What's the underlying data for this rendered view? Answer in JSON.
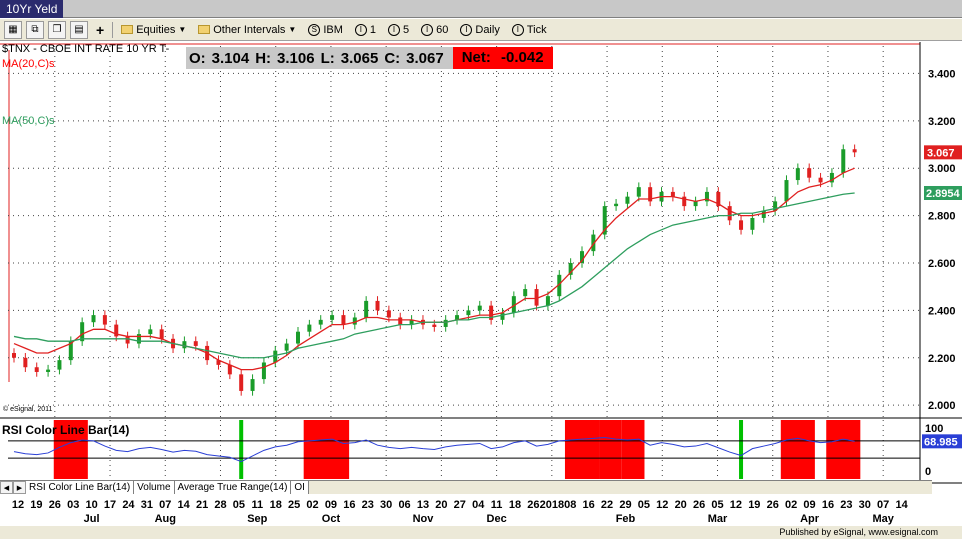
{
  "window": {
    "title": "10Yr Yeld"
  },
  "toolbar": {
    "items": [
      {
        "label": "Equities"
      },
      {
        "label": "Other Intervals"
      },
      {
        "badge": "S",
        "label": "IBM"
      },
      {
        "badge": "I",
        "label": "1"
      },
      {
        "badge": "I",
        "label": "5"
      },
      {
        "badge": "I",
        "label": "60"
      },
      {
        "badge": "I",
        "label": "Daily"
      },
      {
        "badge": "I",
        "label": "Tick"
      }
    ]
  },
  "legend": {
    "symbol": "$TNX - CBOE INT RATE 10 YR T-",
    "ma20": "MA(20,C)s",
    "ma50": "MA(50,C)s",
    "copyright": "© eSignal, 2011"
  },
  "ohlc": {
    "o_label": "O:",
    "o": "3.104",
    "h_label": "H:",
    "h": "3.106",
    "l_label": "L:",
    "l": "3.065",
    "c_label": "C:",
    "c": "3.067",
    "net_label": "Net:",
    "net": "-0.042"
  },
  "tabs": [
    "RSI Color Line Bar(14)",
    "Volume",
    "Average True Range(14)",
    "OI"
  ],
  "footer": "Published by eSignal, www.esignal.com",
  "colors": {
    "up": "#1a9c2a",
    "down": "#e02020",
    "ma20": "#e02020",
    "ma50": "#2e9e5e",
    "rsi": "#2a3fd6",
    "rsi_zone": "#ff0000",
    "alert": "#00c000"
  },
  "chart_data": [
    {
      "type": "candlestick",
      "title": "$TNX - CBOE INT RATE 10 YR T-",
      "ylim": [
        1.95,
        3.52
      ],
      "y_ticks": [
        "2.000",
        "2.200",
        "2.400",
        "2.600",
        "2.800",
        "3.000",
        "3.200",
        "3.400"
      ],
      "x_tick_labels": [
        "12",
        "19",
        "26",
        "03",
        "10",
        "17",
        "24",
        "31",
        "07",
        "14",
        "21",
        "28",
        "05",
        "11",
        "18",
        "25",
        "02",
        "09",
        "16",
        "23",
        "30",
        "06",
        "13",
        "20",
        "27",
        "04",
        "11",
        "18",
        "26",
        "2018",
        "08",
        "16",
        "22",
        "29",
        "05",
        "12",
        "20",
        "26",
        "05",
        "12",
        "19",
        "26",
        "02",
        "09",
        "16",
        "23",
        "30",
        "07",
        "14"
      ],
      "month_labels": [
        "Jul",
        "Aug",
        "Sep",
        "Oct",
        "Nov",
        "Dec",
        "Feb",
        "Mar",
        "Apr",
        "May"
      ],
      "last_price_label": "3.067",
      "ma50_label": "2.8954",
      "series": [
        {
          "name": "$TNX",
          "values": [
            2.2,
            2.16,
            2.14,
            2.15,
            2.19,
            2.27,
            2.35,
            2.38,
            2.34,
            2.29,
            2.26,
            2.3,
            2.32,
            2.28,
            2.24,
            2.27,
            2.25,
            2.19,
            2.17,
            2.13,
            2.06,
            2.11,
            2.18,
            2.23,
            2.26,
            2.31,
            2.34,
            2.36,
            2.38,
            2.34,
            2.37,
            2.44,
            2.4,
            2.37,
            2.34,
            2.36,
            2.34,
            2.33,
            2.36,
            2.38,
            2.4,
            2.42,
            2.36,
            2.39,
            2.46,
            2.49,
            2.42,
            2.46,
            2.55,
            2.6,
            2.65,
            2.72,
            2.84,
            2.85,
            2.88,
            2.92,
            2.86,
            2.9,
            2.88,
            2.84,
            2.86,
            2.9,
            2.84,
            2.78,
            2.74,
            2.79,
            2.82,
            2.86,
            2.95,
            3.0,
            2.96,
            2.94,
            2.98,
            3.08,
            3.067
          ]
        },
        {
          "name": "MA(20,C)s",
          "values": [
            2.26,
            2.24,
            2.22,
            2.22,
            2.24,
            2.26,
            2.3,
            2.32,
            2.32,
            2.3,
            2.29,
            2.29,
            2.29,
            2.28,
            2.26,
            2.25,
            2.24,
            2.22,
            2.19,
            2.17,
            2.15,
            2.15,
            2.16,
            2.18,
            2.21,
            2.25,
            2.28,
            2.31,
            2.34,
            2.34,
            2.35,
            2.37,
            2.37,
            2.36,
            2.36,
            2.36,
            2.35,
            2.35,
            2.35,
            2.36,
            2.37,
            2.38,
            2.38,
            2.39,
            2.42,
            2.45,
            2.45,
            2.47,
            2.51,
            2.56,
            2.61,
            2.68,
            2.74,
            2.79,
            2.83,
            2.87,
            2.87,
            2.88,
            2.88,
            2.87,
            2.86,
            2.87,
            2.85,
            2.82,
            2.8,
            2.8,
            2.81,
            2.82,
            2.86,
            2.9,
            2.92,
            2.93,
            2.95,
            2.98,
            3.0
          ]
        },
        {
          "name": "MA(50,C)s",
          "values": [
            2.29,
            2.28,
            2.28,
            2.27,
            2.27,
            2.27,
            2.28,
            2.28,
            2.28,
            2.28,
            2.28,
            2.27,
            2.27,
            2.27,
            2.26,
            2.25,
            2.24,
            2.23,
            2.22,
            2.21,
            2.2,
            2.2,
            2.2,
            2.21,
            2.22,
            2.24,
            2.25,
            2.26,
            2.27,
            2.28,
            2.3,
            2.31,
            2.32,
            2.33,
            2.34,
            2.34,
            2.35,
            2.35,
            2.35,
            2.36,
            2.36,
            2.37,
            2.37,
            2.38,
            2.39,
            2.4,
            2.41,
            2.42,
            2.44,
            2.47,
            2.5,
            2.54,
            2.58,
            2.62,
            2.66,
            2.69,
            2.72,
            2.74,
            2.76,
            2.77,
            2.78,
            2.79,
            2.8,
            2.8,
            2.81,
            2.81,
            2.82,
            2.83,
            2.84,
            2.85,
            2.86,
            2.87,
            2.88,
            2.89,
            2.8954
          ]
        }
      ]
    },
    {
      "type": "line",
      "title": "RSI Color Line Bar(14)",
      "ylim": [
        0,
        100
      ],
      "y_ticks": [
        "100",
        "0"
      ],
      "last_value_label": "68.985",
      "series": [
        {
          "name": "RSI Color Line Bar(14)",
          "values": [
            45,
            40,
            38,
            42,
            55,
            66,
            72,
            70,
            58,
            48,
            45,
            52,
            55,
            50,
            44,
            48,
            46,
            38,
            35,
            32,
            22,
            35,
            48,
            56,
            60,
            68,
            70,
            72,
            74,
            64,
            66,
            72,
            60,
            55,
            52,
            55,
            52,
            50,
            56,
            60,
            62,
            64,
            52,
            56,
            66,
            70,
            58,
            62,
            70,
            72,
            74,
            76,
            78,
            74,
            72,
            74,
            60,
            66,
            62,
            56,
            58,
            64,
            54,
            44,
            36,
            52,
            58,
            64,
            72,
            76,
            70,
            66,
            68,
            74,
            69
          ]
        }
      ],
      "overbought_runs": [
        [
          4,
          6
        ],
        [
          26,
          29
        ],
        [
          49,
          51
        ],
        [
          52,
          53
        ],
        [
          54,
          55
        ],
        [
          68,
          70
        ],
        [
          72,
          74
        ]
      ],
      "alert_bars": [
        20,
        64
      ]
    }
  ]
}
